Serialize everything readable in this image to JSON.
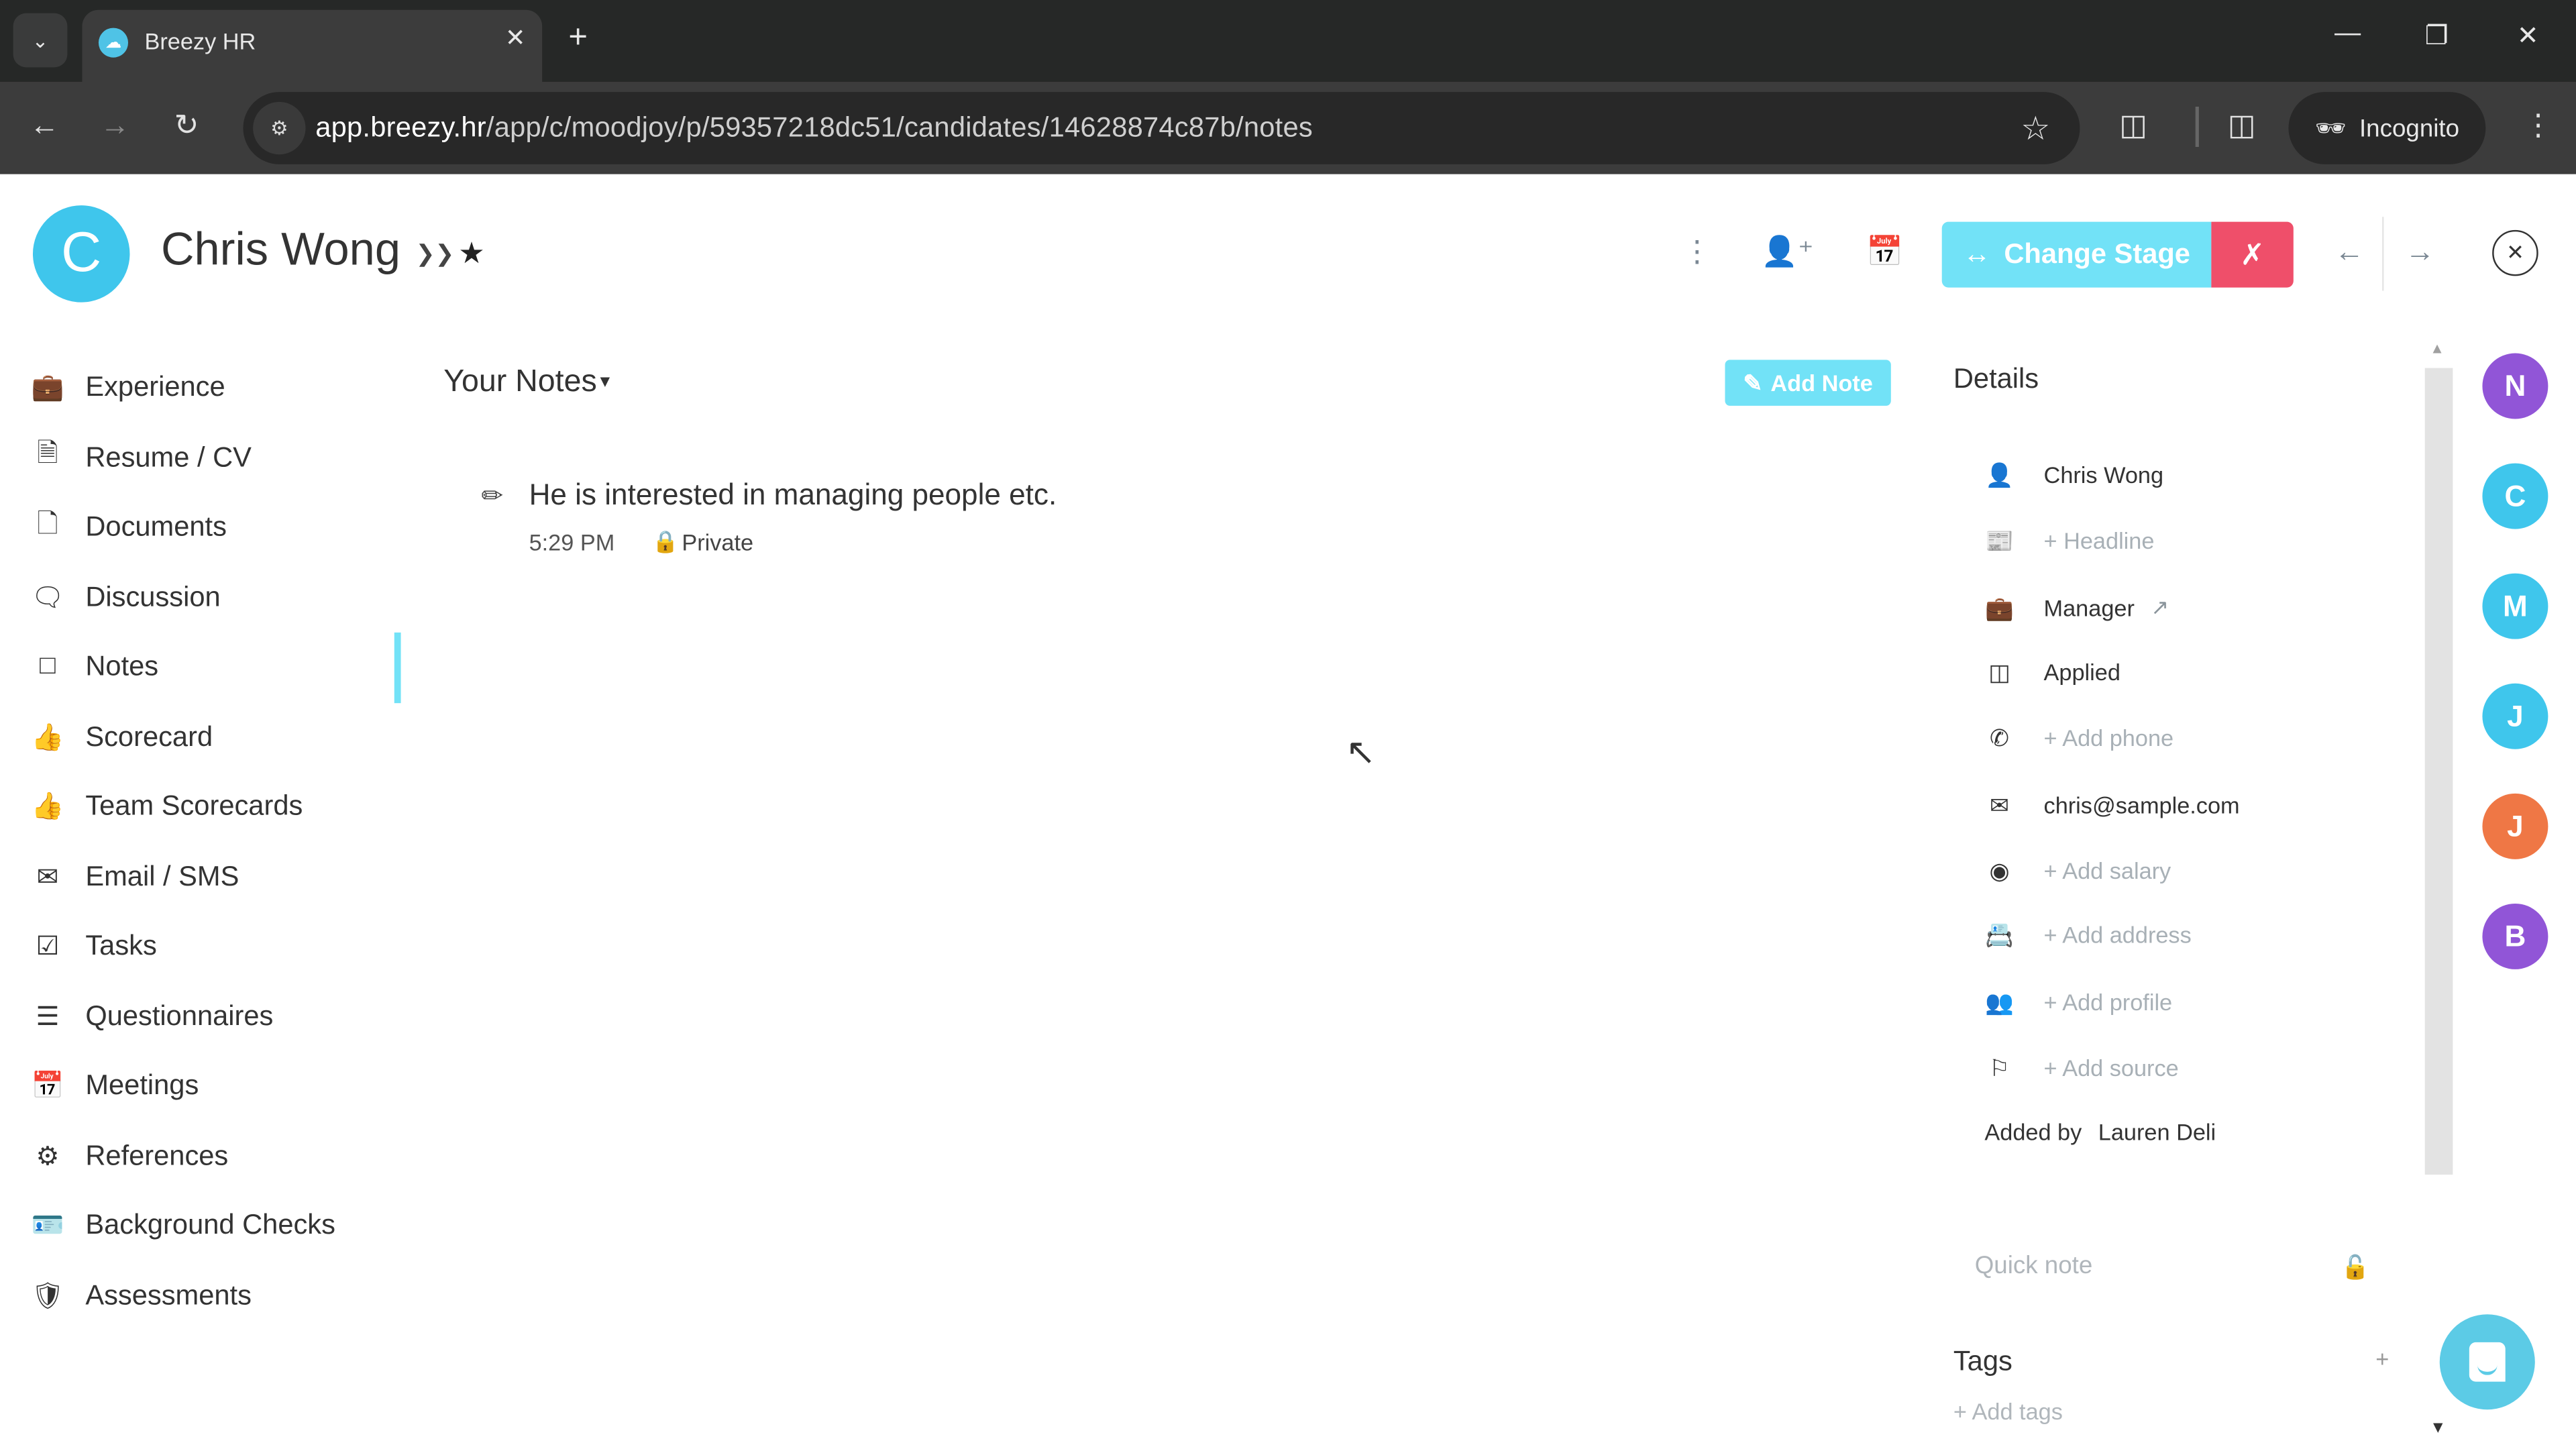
{
  "browser": {
    "tab_title": "Breezy HR",
    "url_host": "app.breezy.hr",
    "url_path": "/app/c/moodjoy/p/59357218dc51/candidates/14628874c87b/notes",
    "incognito_label": "Incognito"
  },
  "candidate": {
    "initial": "C",
    "name": "Chris Wong",
    "avatar_color": "#3fc6ec"
  },
  "header_actions": {
    "change_stage_label": "Change Stage",
    "change_stage_color": "#72e2f7",
    "disqualify_color": "#ef4f6a"
  },
  "sidebar": {
    "active": "Notes",
    "items": [
      {
        "label": "Experience",
        "icon": "briefcase-icon"
      },
      {
        "label": "Resume / CV",
        "icon": "file-text-icon"
      },
      {
        "label": "Documents",
        "icon": "file-icon"
      },
      {
        "label": "Discussion",
        "icon": "chat-bubbles-icon"
      },
      {
        "label": "Notes",
        "icon": "sticky-note-icon"
      },
      {
        "label": "Scorecard",
        "icon": "thumbs-up-icon"
      },
      {
        "label": "Team Scorecards",
        "icon": "thumbs-up-icon"
      },
      {
        "label": "Email / SMS",
        "icon": "envelope-icon"
      },
      {
        "label": "Tasks",
        "icon": "checkbox-icon"
      },
      {
        "label": "Questionnaires",
        "icon": "list-icon"
      },
      {
        "label": "Meetings",
        "icon": "calendar-icon"
      },
      {
        "label": "References",
        "icon": "badge-icon"
      },
      {
        "label": "Background Checks",
        "icon": "id-card-icon"
      },
      {
        "label": "Assessments",
        "icon": "shield-check-icon"
      }
    ]
  },
  "notes": {
    "title": "Your Notes",
    "add_note_label": "Add Note",
    "items": [
      {
        "text": "He is interested in managing people etc.",
        "time": "5:29 PM",
        "privacy": "Private"
      }
    ]
  },
  "details": {
    "title": "Details",
    "rows": [
      {
        "icon": "user-icon",
        "value": "Chris Wong",
        "placeholder": false
      },
      {
        "icon": "newspaper-icon",
        "value": "+ Headline",
        "placeholder": true
      },
      {
        "icon": "briefcase-icon",
        "value": "Manager",
        "placeholder": false,
        "external_link": true
      },
      {
        "icon": "pipeline-stage-icon",
        "value": "Applied",
        "placeholder": false
      },
      {
        "icon": "phone-icon",
        "value": "+ Add phone",
        "placeholder": true
      },
      {
        "icon": "envelope-icon",
        "value": "chris@sample.com",
        "placeholder": false
      },
      {
        "icon": "money-icon",
        "value": "+ Add salary",
        "placeholder": true
      },
      {
        "icon": "address-book-icon",
        "value": "+ Add address",
        "placeholder": true
      },
      {
        "icon": "users-icon",
        "value": "+ Add profile",
        "placeholder": true
      },
      {
        "icon": "flag-icon",
        "value": "+ Add source",
        "placeholder": true
      }
    ],
    "added_by_label": "Added by",
    "added_by_name": "Lauren Deli",
    "quick_note_placeholder": "Quick note",
    "tags_title": "Tags",
    "add_tags_label": "+ Add tags"
  },
  "pipeline_avatars": [
    {
      "initial": "N",
      "color": "#9155d7"
    },
    {
      "initial": "C",
      "color": "#3fc6ec"
    },
    {
      "initial": "M",
      "color": "#3fc6ec"
    },
    {
      "initial": "J",
      "color": "#3fc6ec"
    },
    {
      "initial": "J",
      "color": "#ef7745"
    },
    {
      "initial": "B",
      "color": "#9155d7"
    }
  ]
}
